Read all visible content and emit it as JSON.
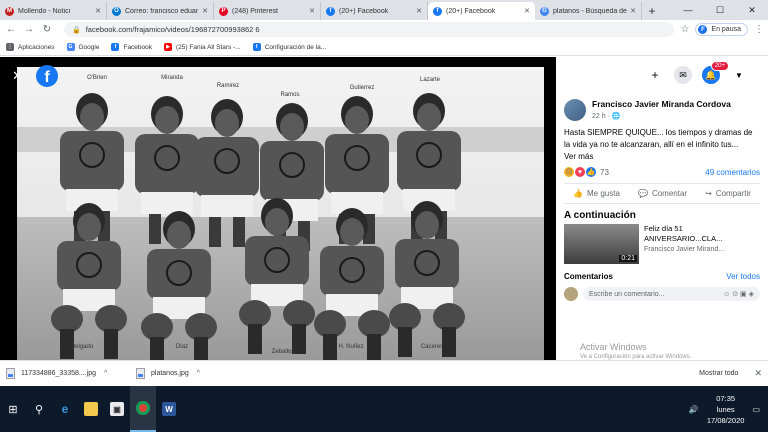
{
  "tabs": [
    {
      "title": "Mollendo - Notici",
      "color": "#c5221f",
      "glyph": "M"
    },
    {
      "title": "Correo: francisco eduar",
      "color": "#0078d4",
      "glyph": "O"
    },
    {
      "title": "(248) Pinterest",
      "color": "#e60023",
      "glyph": "P"
    },
    {
      "title": "(20+) Facebook",
      "color": "#1877f2",
      "glyph": "f"
    },
    {
      "title": "(20+) Facebook",
      "color": "#1877f2",
      "glyph": "f"
    },
    {
      "title": "platanos - Búsqueda de",
      "color": "#4285f4",
      "glyph": "G"
    }
  ],
  "address": {
    "url": "facebook.com/frajamico/videos/196872700993862 6",
    "profile_label": "En pausa",
    "profile_initial": "F"
  },
  "bookmarks": [
    {
      "label": "Aplicaciones",
      "color": "#5f6368",
      "glyph": "⋮"
    },
    {
      "label": "Google",
      "color": "#4285f4",
      "glyph": "G"
    },
    {
      "label": "Facebook",
      "color": "#1877f2",
      "glyph": "f"
    },
    {
      "label": "(25) Fania All Stars -...",
      "color": "#ff0000",
      "glyph": "▶"
    },
    {
      "label": "Configuración de la...",
      "color": "#1877f2",
      "glyph": "f"
    }
  ],
  "photo": {
    "player_names": {
      "obrien": "O'Brien",
      "miranda": "Miranda",
      "ramirez": "Ramirez",
      "ramos": "Ramos",
      "gutierrez": "Gutierrez",
      "lazarte": "Lazarte",
      "delgado": "Delgado",
      "diaz": "Díaz",
      "zeballos": "Zeballos",
      "nunez": "H. Nuñez",
      "caceres": "Cáceres"
    }
  },
  "header": {
    "notif_count": "20+"
  },
  "post": {
    "author": "Francisco Javier Miranda Cordova",
    "time": "22 h ·",
    "text": "Hasta SIEMPRE QUIQUE... los tiempos y dramas de la vida ya no te alcanzaran, allí en el infinito tus...",
    "more": "Ver más",
    "reaction_count": "73",
    "comment_count": "49 comentarios",
    "actions": {
      "like": "Me gusta",
      "comment": "Comentar",
      "share": "Compartir"
    }
  },
  "next": {
    "heading": "A continuación",
    "title": "Feliz día 51 ANIVERSARIO...CLA...",
    "author": "Francisco Javier Mirand...",
    "duration": "0:21"
  },
  "comments": {
    "heading": "Comentarios",
    "see_all": "Ver todos",
    "placeholder": "Escribe un comentario..."
  },
  "watermark": {
    "line1": "Activar Windows",
    "line2": "Ve a Configuración para activar Windows."
  },
  "downloads": {
    "files": [
      "117334886_33358....jpg",
      "platanos.jpg"
    ],
    "show_all": "Mostrar todo"
  },
  "clock": {
    "time": "07:35",
    "day": "lunes",
    "date": "17/08/2020"
  }
}
